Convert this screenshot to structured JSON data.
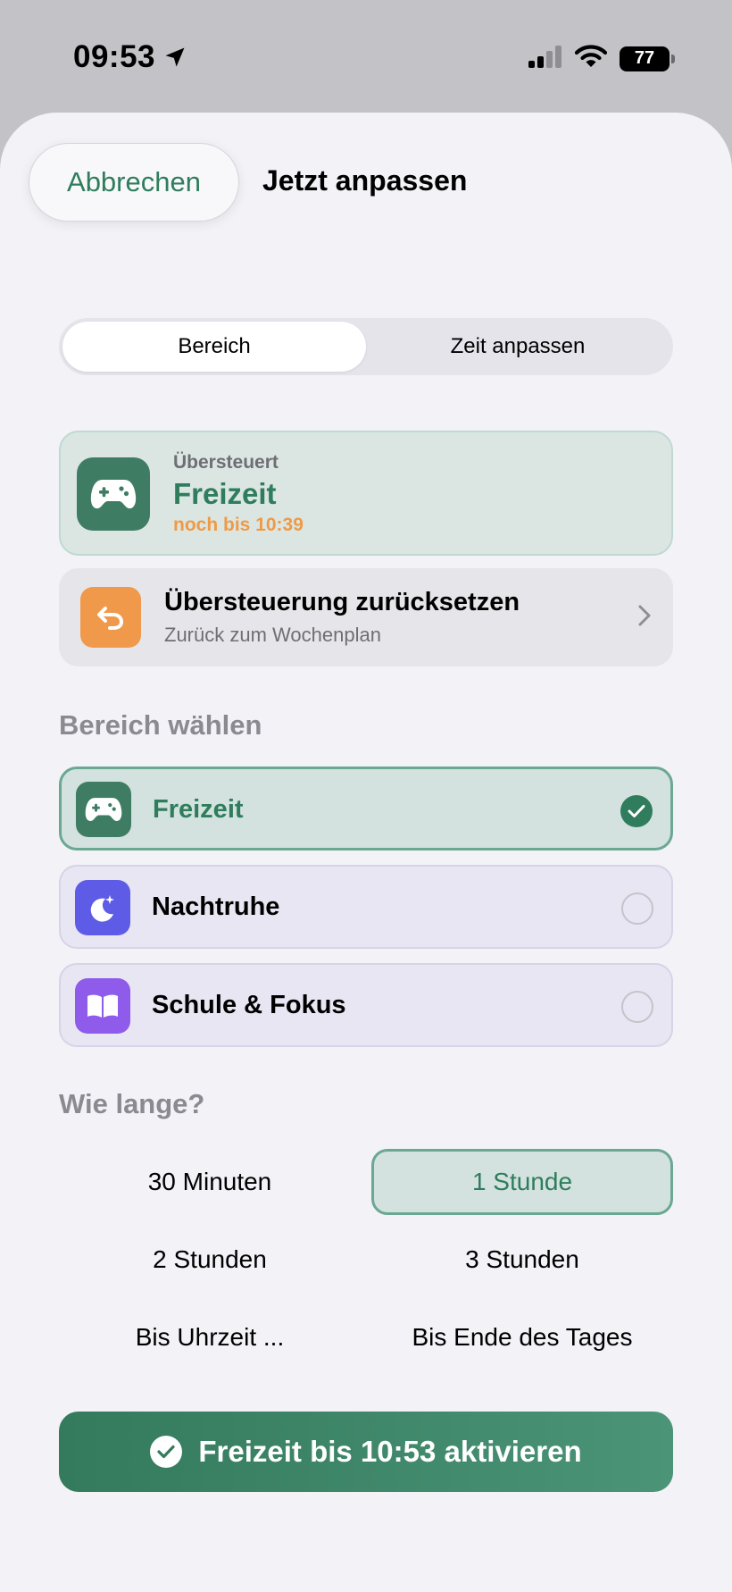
{
  "status_bar": {
    "time": "09:53",
    "battery": "77"
  },
  "header": {
    "cancel_label": "Abbrechen",
    "title": "Jetzt anpassen"
  },
  "segments": [
    {
      "label": "Bereich",
      "active": true
    },
    {
      "label": "Zeit anpassen",
      "active": false
    }
  ],
  "override": {
    "label": "Übersteuert",
    "title": "Freizeit",
    "until": "noch bis 10:39"
  },
  "reset": {
    "title": "Übersteuerung zurücksetzen",
    "subtitle": "Zurück zum Wochenplan"
  },
  "areas": {
    "section_label": "Bereich wählen",
    "items": [
      {
        "label": "Freizeit",
        "icon": "gamepad-icon",
        "color": "#3e7d64",
        "selected": true
      },
      {
        "label": "Nachtruhe",
        "icon": "moon-icon",
        "color": "#5e5ce6",
        "selected": false
      },
      {
        "label": "Schule & Fokus",
        "icon": "book-icon",
        "color": "#8e5bea",
        "selected": false
      }
    ]
  },
  "duration": {
    "section_label": "Wie lange?",
    "options": [
      {
        "label": "30 Minuten",
        "selected": false
      },
      {
        "label": "1 Stunde",
        "selected": true
      },
      {
        "label": "2 Stunden",
        "selected": false
      },
      {
        "label": "3 Stunden",
        "selected": false
      },
      {
        "label": "Bis Uhrzeit ...",
        "selected": false
      },
      {
        "label": "Bis Ende des Tages",
        "selected": false
      }
    ]
  },
  "activate_label": "Freizeit bis 10:53 aktivieren",
  "colors": {
    "accent": "#2f7d5c",
    "orange": "#ef9a46",
    "sheet": "#f2f2f7"
  }
}
